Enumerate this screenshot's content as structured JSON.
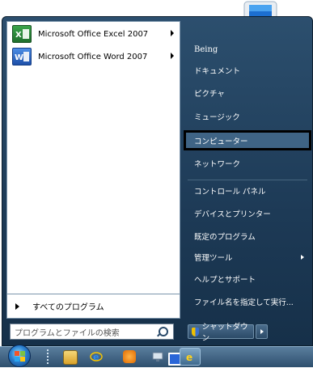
{
  "start_menu": {
    "pinned_programs": [
      {
        "label": "Microsoft Office Excel 2007",
        "icon": "excel-icon",
        "has_submenu": true
      },
      {
        "label": "Microsoft Office Word 2007",
        "icon": "word-icon",
        "has_submenu": true
      }
    ],
    "all_programs_label": "すべてのプログラム",
    "search": {
      "placeholder": "プログラムとファイルの検索"
    },
    "user_name": "Being",
    "right_items": [
      {
        "label": "ドキュメント"
      },
      {
        "label": "ピクチャ"
      },
      {
        "label": "ミュージック"
      },
      {
        "label": "コンピューター",
        "highlighted": true
      },
      {
        "label": "ネットワーク"
      },
      {
        "label": "コントロール パネル"
      },
      {
        "label": "デバイスとプリンター"
      },
      {
        "label": "既定のプログラム"
      },
      {
        "label": "管理ツール",
        "has_submenu": true
      },
      {
        "label": "ヘルプとサポート"
      },
      {
        "label": "ファイル名を指定して実行..."
      }
    ],
    "shutdown_label": "シャットダウン"
  },
  "taskbar": {
    "icons": [
      "start-orb-icon",
      "explorer-icon",
      "internet-explorer-icon",
      "media-player-icon",
      "network-icon",
      "app-icon",
      "ie-active-icon"
    ]
  },
  "colors": {
    "menu_bg": "#1d3a56",
    "highlight_border": "#000000"
  }
}
